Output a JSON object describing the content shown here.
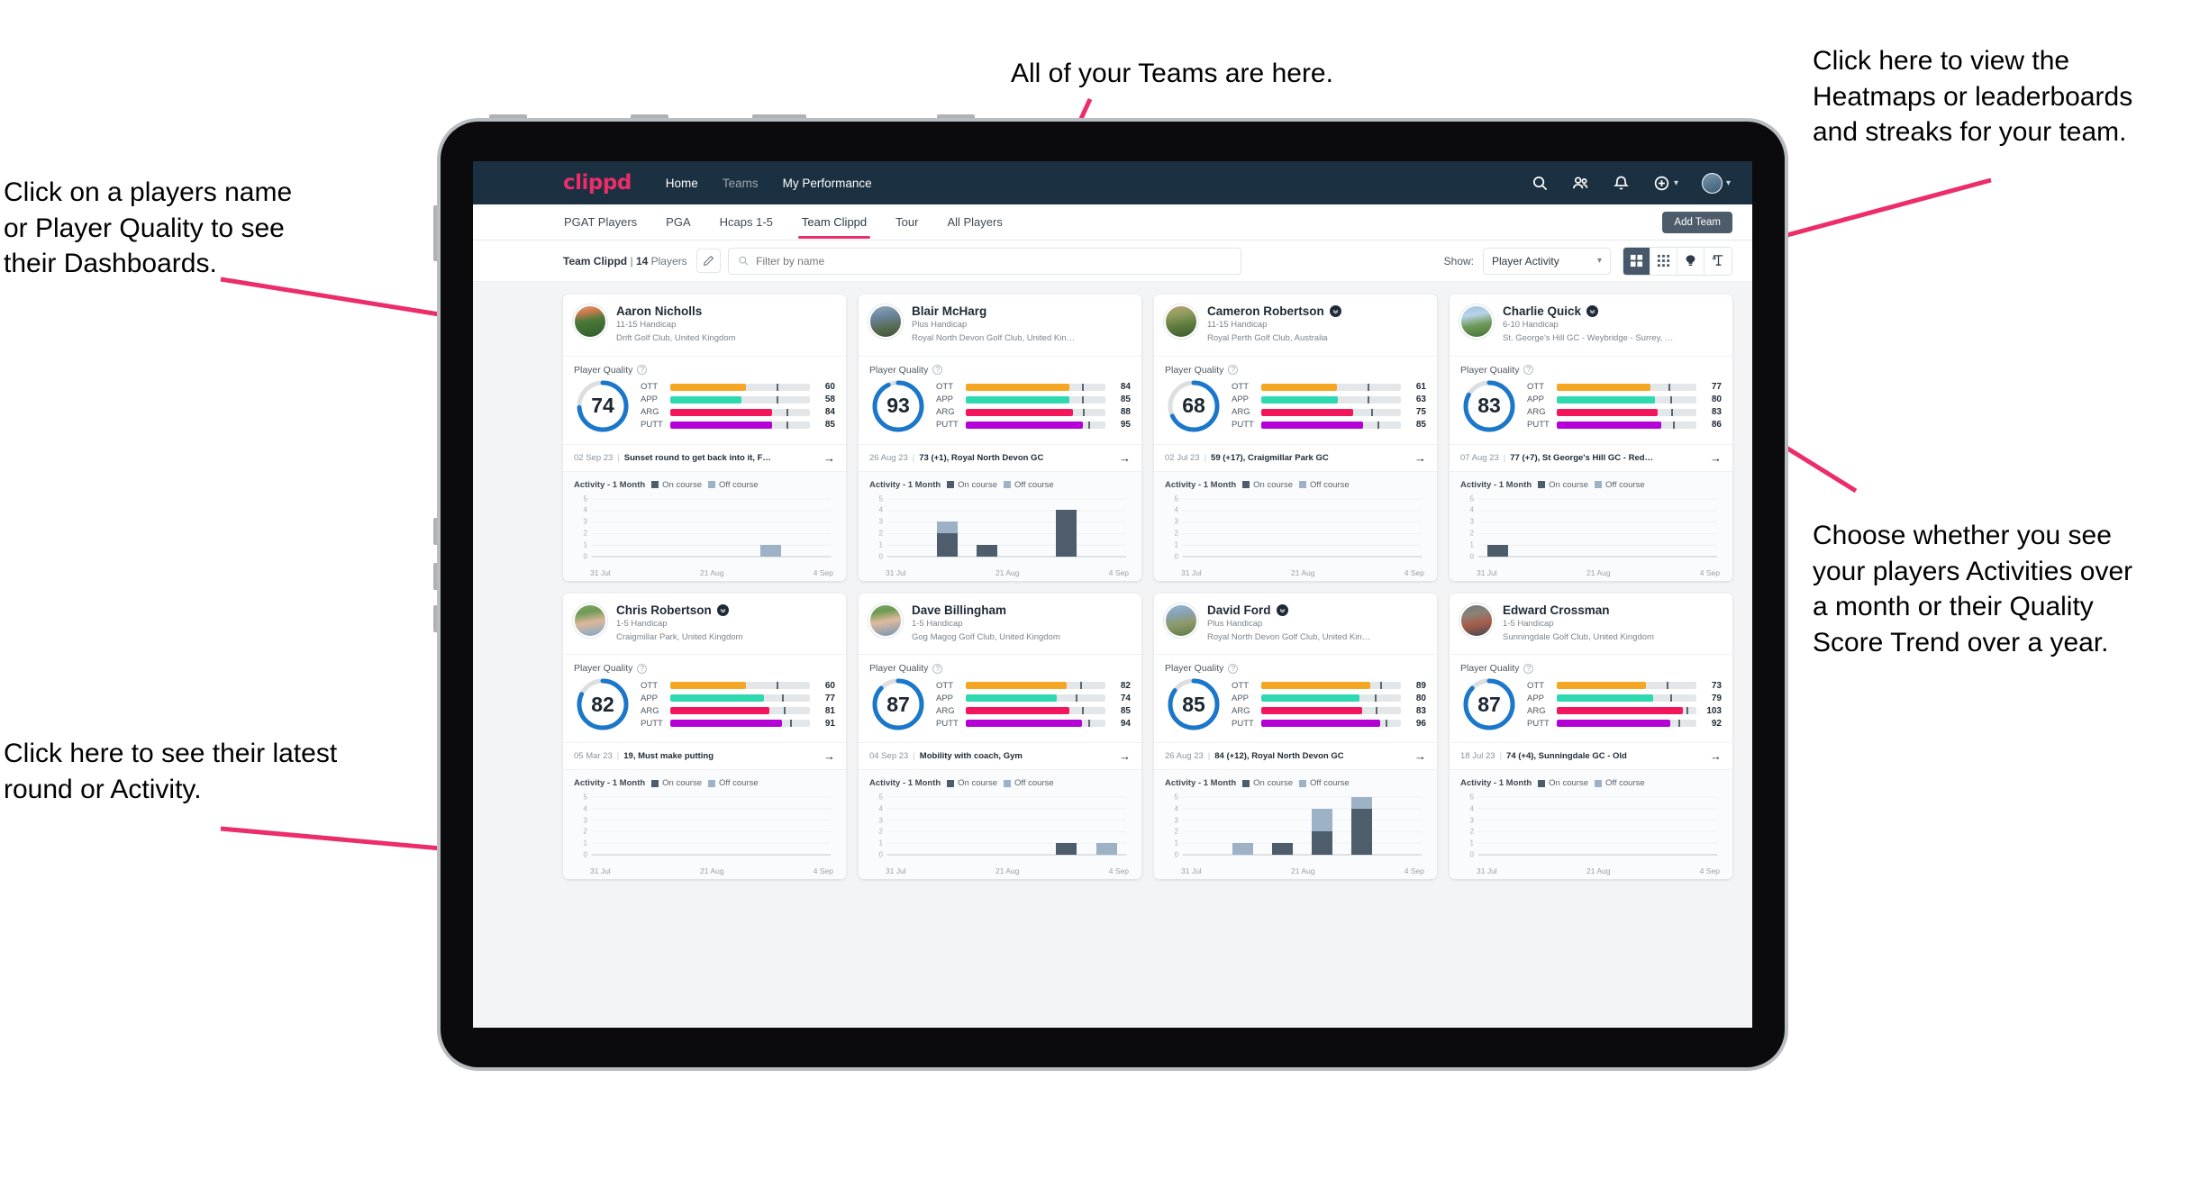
{
  "annotations": {
    "top": "All of your Teams are here.",
    "left_top": "Click on a players name\nor Player Quality to see\ntheir Dashboards.",
    "left_bottom": "Click here to see their latest\nround or Activity.",
    "right_top": "Click here to view the\nHeatmaps or leaderboards\nand streaks for your team.",
    "right_bottom": "Choose whether you see\nyour players Activities over\na month or their Quality\nScore Trend over a year.",
    "arrow_color": "#ec2d6a"
  },
  "topnav": {
    "logo": "clippd",
    "links": [
      {
        "label": "Home",
        "active": true
      },
      {
        "label": "Teams",
        "active": false
      },
      {
        "label": "My Performance",
        "active": true
      }
    ],
    "icons": [
      "search-icon",
      "people-icon",
      "bell-icon",
      "plus-circle-icon",
      "avatar"
    ]
  },
  "tabs": [
    {
      "label": "PGAT Players",
      "active": false
    },
    {
      "label": "PGA",
      "active": false
    },
    {
      "label": "Hcaps 1-5",
      "active": false
    },
    {
      "label": "Team Clippd",
      "active": true
    },
    {
      "label": "Tour",
      "active": false
    },
    {
      "label": "All Players",
      "active": false
    }
  ],
  "add_team_label": "Add Team",
  "toolbar": {
    "team_name": "Team Clippd",
    "separator": "|",
    "player_count": "14",
    "players_word": "Players",
    "edit_icon": "pencil-icon",
    "search_placeholder": "Filter by name",
    "show_label": "Show:",
    "show_value": "Player Activity",
    "show_options": [
      "Player Activity",
      "Quality Score Trend"
    ],
    "views": [
      {
        "name": "grid-large-view",
        "active": true
      },
      {
        "name": "grid-small-view",
        "active": false
      },
      {
        "name": "heatmap-view",
        "active": false
      },
      {
        "name": "leaderboard-view",
        "active": false
      }
    ]
  },
  "card_labels": {
    "player_quality": "Player Quality",
    "help_icon": "help-icon",
    "activity": "Activity - 1 Month",
    "legend_on": "On course",
    "legend_off": "Off course",
    "arrow": "→",
    "metrics": [
      "OTT",
      "APP",
      "ARG",
      "PUTT"
    ],
    "x_ticks": [
      "31 Jul",
      "21 Aug",
      "4 Sep"
    ],
    "y_ticks": [
      "5",
      "4",
      "3",
      "2",
      "1",
      "0"
    ]
  },
  "colors": {
    "ott": "#f5a623",
    "app": "#2ed9b0",
    "arg": "#f4165c",
    "putt": "#b400d6",
    "ring": "#1b77c9",
    "ring_track": "#dcdfe2",
    "on_course": "#4e5d6b",
    "off_course": "#9db2c6",
    "accent": "#ec2d6a",
    "nav_bg": "#1b3040"
  },
  "players": [
    {
      "name": "Aaron Nicholls",
      "verified": false,
      "handicap": "11-15 Handicap",
      "club": "Drift Golf Club, United Kingdom",
      "quality": 74,
      "avatar_css": "linear-gradient(170deg,#e8a06a 0%,#c97a4e 22%,#4c7a3a 46%,#2f5c28 100%)",
      "metrics": [
        {
          "label": "OTT",
          "value": 60,
          "fill": 54,
          "tick": 76
        },
        {
          "label": "APP",
          "value": 58,
          "fill": 51,
          "tick": 76
        },
        {
          "label": "ARG",
          "value": 84,
          "fill": 73,
          "tick": 83
        },
        {
          "label": "PUTT",
          "value": 85,
          "fill": 73,
          "tick": 83
        }
      ],
      "round_date": "02 Sep 23",
      "round_text": "Sunset round to get back into it, F…",
      "activity": [
        {
          "on": 0,
          "off": 0
        },
        {
          "on": 0,
          "off": 0
        },
        {
          "on": 0,
          "off": 0
        },
        {
          "on": 0,
          "off": 0
        },
        {
          "on": 0,
          "off": 1
        },
        {
          "on": 0,
          "off": 0
        }
      ]
    },
    {
      "name": "Blair McHarg",
      "verified": false,
      "handicap": "Plus Handicap",
      "club": "Royal North Devon Golf Club, United Kin…",
      "quality": 93,
      "avatar_css": "linear-gradient(170deg,#8fa7bd 0%,#6a8399 35%,#586b53 68%,#3e5339 100%)",
      "metrics": [
        {
          "label": "OTT",
          "value": 84,
          "fill": 74,
          "tick": 83
        },
        {
          "label": "APP",
          "value": 85,
          "fill": 74,
          "tick": 83
        },
        {
          "label": "ARG",
          "value": 88,
          "fill": 77,
          "tick": 84
        },
        {
          "label": "PUTT",
          "value": 95,
          "fill": 84,
          "tick": 88
        }
      ],
      "round_date": "26 Aug 23",
      "round_text": "73 (+1), Royal North Devon GC",
      "activity": [
        {
          "on": 0,
          "off": 0
        },
        {
          "on": 2,
          "off": 1
        },
        {
          "on": 1,
          "off": 0
        },
        {
          "on": 0,
          "off": 0
        },
        {
          "on": 4,
          "off": 0
        },
        {
          "on": 0,
          "off": 0
        }
      ]
    },
    {
      "name": "Cameron Robertson",
      "verified": true,
      "handicap": "11-15 Handicap",
      "club": "Royal Perth Golf Club, Australia",
      "quality": 68,
      "avatar_css": "linear-gradient(170deg,#b9a472 0%,#8f9a5c 30%,#5d7a3e 62%,#3c5c2c 100%)",
      "metrics": [
        {
          "label": "OTT",
          "value": 61,
          "fill": 54,
          "tick": 76
        },
        {
          "label": "APP",
          "value": 63,
          "fill": 55,
          "tick": 76
        },
        {
          "label": "ARG",
          "value": 75,
          "fill": 66,
          "tick": 79
        },
        {
          "label": "PUTT",
          "value": 85,
          "fill": 73,
          "tick": 83
        }
      ],
      "round_date": "02 Jul 23",
      "round_text": "59 (+17), Craigmillar Park GC",
      "activity": [
        {
          "on": 0,
          "off": 0
        },
        {
          "on": 0,
          "off": 0
        },
        {
          "on": 0,
          "off": 0
        },
        {
          "on": 0,
          "off": 0
        },
        {
          "on": 0,
          "off": 0
        },
        {
          "on": 0,
          "off": 0
        }
      ]
    },
    {
      "name": "Charlie Quick",
      "verified": true,
      "handicap": "6-10 Handicap",
      "club": "St. George's Hill GC - Weybridge - Surrey, …",
      "quality": 83,
      "avatar_css": "linear-gradient(170deg,#9fc4e0 0%,#b7d3e8 30%,#6f9a58 60%,#45713a 100%)",
      "metrics": [
        {
          "label": "OTT",
          "value": 77,
          "fill": 67,
          "tick": 80
        },
        {
          "label": "APP",
          "value": 80,
          "fill": 70,
          "tick": 81
        },
        {
          "label": "ARG",
          "value": 83,
          "fill": 72,
          "tick": 82
        },
        {
          "label": "PUTT",
          "value": 86,
          "fill": 75,
          "tick": 83
        }
      ],
      "round_date": "07 Aug 23",
      "round_text": "77 (+7), St George's Hill GC - Red…",
      "activity": [
        {
          "on": 1,
          "off": 0
        },
        {
          "on": 0,
          "off": 0
        },
        {
          "on": 0,
          "off": 0
        },
        {
          "on": 0,
          "off": 0
        },
        {
          "on": 0,
          "off": 0
        },
        {
          "on": 0,
          "off": 0
        }
      ]
    },
    {
      "name": "Chris Robertson",
      "verified": true,
      "handicap": "1-5 Handicap",
      "club": "Craigmillar Park, United Kingdom",
      "quality": 82,
      "avatar_css": "linear-gradient(170deg,#84a96a 0%,#6d9a55 25%,#dcb79a 55%,#7fa8cd 100%)",
      "metrics": [
        {
          "label": "OTT",
          "value": 60,
          "fill": 54,
          "tick": 76
        },
        {
          "label": "APP",
          "value": 77,
          "fill": 67,
          "tick": 80
        },
        {
          "label": "ARG",
          "value": 81,
          "fill": 71,
          "tick": 81
        },
        {
          "label": "PUTT",
          "value": 91,
          "fill": 80,
          "tick": 86
        }
      ],
      "round_date": "05 Mar 23",
      "round_text": "19, Must make putting",
      "activity": [
        {
          "on": 0,
          "off": 0
        },
        {
          "on": 0,
          "off": 0
        },
        {
          "on": 0,
          "off": 0
        },
        {
          "on": 0,
          "off": 0
        },
        {
          "on": 0,
          "off": 0
        },
        {
          "on": 0,
          "off": 0
        }
      ]
    },
    {
      "name": "Dave Billingham",
      "verified": false,
      "handicap": "1-5 Handicap",
      "club": "Gog Magog Golf Club, United Kingdom",
      "quality": 87,
      "avatar_css": "linear-gradient(170deg,#7fa861 0%,#6c9a52 22%,#e0bb9e 52%,#6f94b5 100%)",
      "metrics": [
        {
          "label": "OTT",
          "value": 82,
          "fill": 72,
          "tick": 82
        },
        {
          "label": "APP",
          "value": 74,
          "fill": 65,
          "tick": 79
        },
        {
          "label": "ARG",
          "value": 85,
          "fill": 74,
          "tick": 83
        },
        {
          "label": "PUTT",
          "value": 94,
          "fill": 83,
          "tick": 88
        }
      ],
      "round_date": "04 Sep 23",
      "round_text": "Mobility with coach, Gym",
      "activity": [
        {
          "on": 0,
          "off": 0
        },
        {
          "on": 0,
          "off": 0
        },
        {
          "on": 0,
          "off": 0
        },
        {
          "on": 0,
          "off": 0
        },
        {
          "on": 1,
          "off": 0
        },
        {
          "on": 0,
          "off": 1
        }
      ]
    },
    {
      "name": "David Ford",
      "verified": true,
      "handicap": "Plus Handicap",
      "club": "Royal North Devon Golf Club, United Kin…",
      "quality": 85,
      "avatar_css": "linear-gradient(170deg,#9bb8cf 0%,#86a3b8 28%,#8f9a6b 58%,#5f7a46 100%)",
      "metrics": [
        {
          "label": "OTT",
          "value": 89,
          "fill": 78,
          "tick": 85
        },
        {
          "label": "APP",
          "value": 80,
          "fill": 70,
          "tick": 81
        },
        {
          "label": "ARG",
          "value": 83,
          "fill": 72,
          "tick": 82
        },
        {
          "label": "PUTT",
          "value": 96,
          "fill": 85,
          "tick": 89
        }
      ],
      "round_date": "26 Aug 23",
      "round_text": "84 (+12), Royal North Devon GC",
      "activity": [
        {
          "on": 0,
          "off": 0
        },
        {
          "on": 0,
          "off": 1
        },
        {
          "on": 1,
          "off": 0
        },
        {
          "on": 2,
          "off": 2
        },
        {
          "on": 4,
          "off": 1
        },
        {
          "on": 0,
          "off": 0
        }
      ]
    },
    {
      "name": "Edward Crossman",
      "verified": false,
      "handicap": "1-5 Handicap",
      "club": "Sunningdale Golf Club, United Kingdom",
      "quality": 87,
      "avatar_css": "linear-gradient(170deg,#6f7a84 0%,#8c8276 30%,#a85c4a 60%,#3f4a52 100%)",
      "metrics": [
        {
          "label": "OTT",
          "value": 73,
          "fill": 64,
          "tick": 79
        },
        {
          "label": "APP",
          "value": 79,
          "fill": 69,
          "tick": 81
        },
        {
          "label": "ARG",
          "value": 103,
          "fill": 90,
          "tick": 93
        },
        {
          "label": "PUTT",
          "value": 92,
          "fill": 81,
          "tick": 87
        }
      ],
      "round_date": "18 Jul 23",
      "round_text": "74 (+4), Sunningdale GC - Old",
      "activity": [
        {
          "on": 0,
          "off": 0
        },
        {
          "on": 0,
          "off": 0
        },
        {
          "on": 0,
          "off": 0
        },
        {
          "on": 0,
          "off": 0
        },
        {
          "on": 0,
          "off": 0
        },
        {
          "on": 0,
          "off": 0
        }
      ]
    }
  ]
}
